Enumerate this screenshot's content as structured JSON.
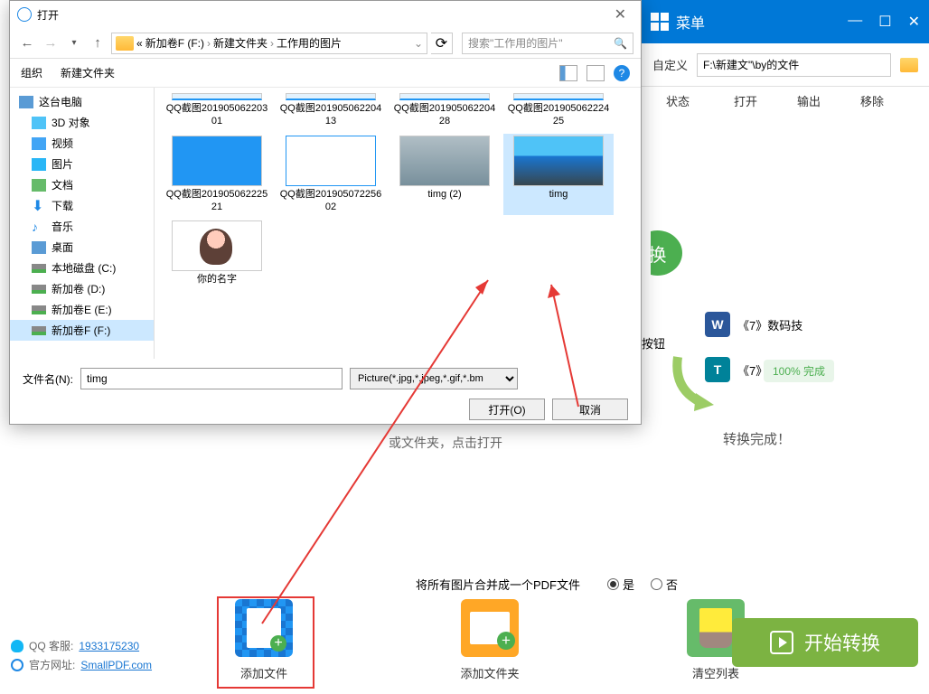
{
  "app_header": {
    "menu": "菜单"
  },
  "toolbar": {
    "custom": "自定义",
    "path": "F:\\新建文\"\\by的文件"
  },
  "columns": [
    "状态",
    "打开",
    "输出",
    "移除"
  ],
  "right": {
    "convert": "换",
    "btn_text": "按钮",
    "doc_w": "《7》数码技",
    "doc_t": "《7》",
    "complete_badge": "100% 完成",
    "complete_text": "转换完成！"
  },
  "mid_text": "或文件夹，点击打开",
  "bottom_question": "将所有图片合并成一个PDF文件",
  "radio_yes": "是",
  "radio_no": "否",
  "actions": {
    "add_file": "添加文件",
    "add_folder": "添加文件夹",
    "clear": "清空列表"
  },
  "start_btn": "开始转换",
  "footer": {
    "qq_label": "QQ 客服:",
    "qq_num": "1933175230",
    "site_label": "官方网址:",
    "site_url": "SmallPDF.com"
  },
  "dialog": {
    "title": "打开",
    "breadcrumb": [
      "新加卷F (F:)",
      "新建文件夹",
      "工作用的图片"
    ],
    "search_placeholder": "搜索\"工作用的图片\"",
    "organize": "组织",
    "new_folder": "新建文件夹",
    "sidebar": {
      "root": "这台电脑",
      "items": [
        "3D 对象",
        "视频",
        "图片",
        "文档",
        "下载",
        "音乐",
        "桌面",
        "本地磁盘 (C:)",
        "新加卷 (D:)",
        "新加卷E (E:)",
        "新加卷F (F:)"
      ]
    },
    "files": [
      {
        "name": "QQ截图20190506220301",
        "type": "cut"
      },
      {
        "name": "QQ截图20190506220413",
        "type": "cut"
      },
      {
        "name": "QQ截图20190506220428",
        "type": "cut"
      },
      {
        "name": "QQ截图20190506222425",
        "type": "cut"
      },
      {
        "name": "QQ截图20190506222521",
        "type": "app"
      },
      {
        "name": "QQ截图20190507225602",
        "type": "app2"
      },
      {
        "name": "timg (2)",
        "type": "photo1"
      },
      {
        "name": "timg",
        "type": "photo2",
        "sel": true
      },
      {
        "name": "你的名字",
        "type": "anime"
      }
    ],
    "filename_label": "文件名(N):",
    "filename_value": "timg",
    "filetype": "Picture(*.jpg,*.jpeg,*.gif,*.bm",
    "open_btn": "打开(O)",
    "cancel_btn": "取消"
  }
}
